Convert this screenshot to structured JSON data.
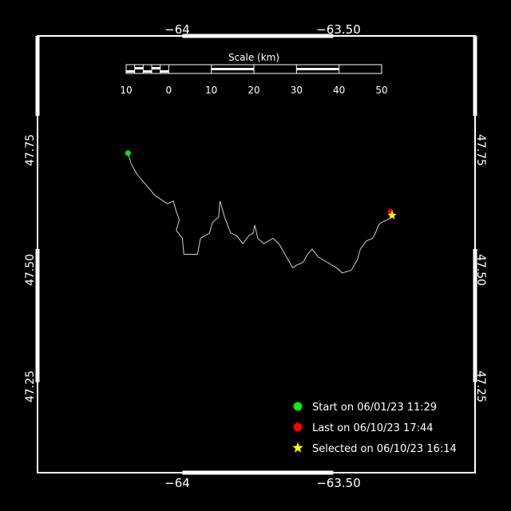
{
  "map": {
    "x_ticks": [
      {
        "value": -64.0,
        "label": "−64"
      },
      {
        "value": -63.5,
        "label": "−63.50"
      }
    ],
    "y_ticks": [
      {
        "value": 47.75,
        "label": "47.75"
      },
      {
        "value": 47.5,
        "label": "47.50"
      },
      {
        "value": 47.25,
        "label": "47.25"
      }
    ],
    "lon_range": [
      -64.48,
      -63.03
    ],
    "lat_range": [
      47.08,
      47.9
    ]
  },
  "scale_bar": {
    "title": "Scale (km)",
    "labels": [
      "10",
      "0",
      "10",
      "20",
      "30",
      "40",
      "50"
    ]
  },
  "track": {
    "points": [
      [
        -64.18,
        47.68
      ],
      [
        -64.17,
        47.66
      ],
      [
        -64.15,
        47.64
      ],
      [
        -64.12,
        47.62
      ],
      [
        -64.09,
        47.6
      ],
      [
        -64.05,
        47.585
      ],
      [
        -64.03,
        47.59
      ],
      [
        -64.02,
        47.57
      ],
      [
        -64.01,
        47.555
      ],
      [
        -64.02,
        47.535
      ],
      [
        -64.0,
        47.52
      ],
      [
        -63.995,
        47.49
      ],
      [
        -63.975,
        47.49
      ],
      [
        -63.95,
        47.49
      ],
      [
        -63.94,
        47.52
      ],
      [
        -63.91,
        47.53
      ],
      [
        -63.9,
        47.55
      ],
      [
        -63.88,
        47.56
      ],
      [
        -63.875,
        47.59
      ],
      [
        -63.86,
        47.56
      ],
      [
        -63.84,
        47.53
      ],
      [
        -63.82,
        47.525
      ],
      [
        -63.8,
        47.51
      ],
      [
        -63.78,
        47.525
      ],
      [
        -63.765,
        47.53
      ],
      [
        -63.76,
        47.545
      ],
      [
        -63.75,
        47.52
      ],
      [
        -63.73,
        47.51
      ],
      [
        -63.7,
        47.52
      ],
      [
        -63.68,
        47.51
      ],
      [
        -63.66,
        47.49
      ],
      [
        -63.635,
        47.465
      ],
      [
        -63.62,
        47.47
      ],
      [
        -63.6,
        47.475
      ],
      [
        -63.585,
        47.49
      ],
      [
        -63.57,
        47.5
      ],
      [
        -63.55,
        47.485
      ],
      [
        -63.52,
        47.475
      ],
      [
        -63.49,
        47.465
      ],
      [
        -63.47,
        47.455
      ],
      [
        -63.44,
        47.46
      ],
      [
        -63.42,
        47.48
      ],
      [
        -63.41,
        47.5
      ],
      [
        -63.39,
        47.515
      ],
      [
        -63.37,
        47.52
      ],
      [
        -63.36,
        47.53
      ],
      [
        -63.35,
        47.545
      ],
      [
        -63.34,
        47.55
      ],
      [
        -63.32,
        47.555
      ],
      [
        -63.305,
        47.56
      ],
      [
        -63.31,
        47.57
      ]
    ],
    "start": [
      -64.18,
      47.68
    ],
    "last": [
      -63.31,
      47.57
    ],
    "selected": [
      -63.305,
      47.563
    ]
  },
  "legend": {
    "start": {
      "label": "Start on 06/01/23 11:29",
      "color": "#00ee00"
    },
    "last": {
      "label": "Last on 06/10/23 17:44",
      "color": "#ff0000"
    },
    "selected": {
      "label": "Selected on 06/10/23 16:14",
      "color": "#ffff00"
    }
  }
}
